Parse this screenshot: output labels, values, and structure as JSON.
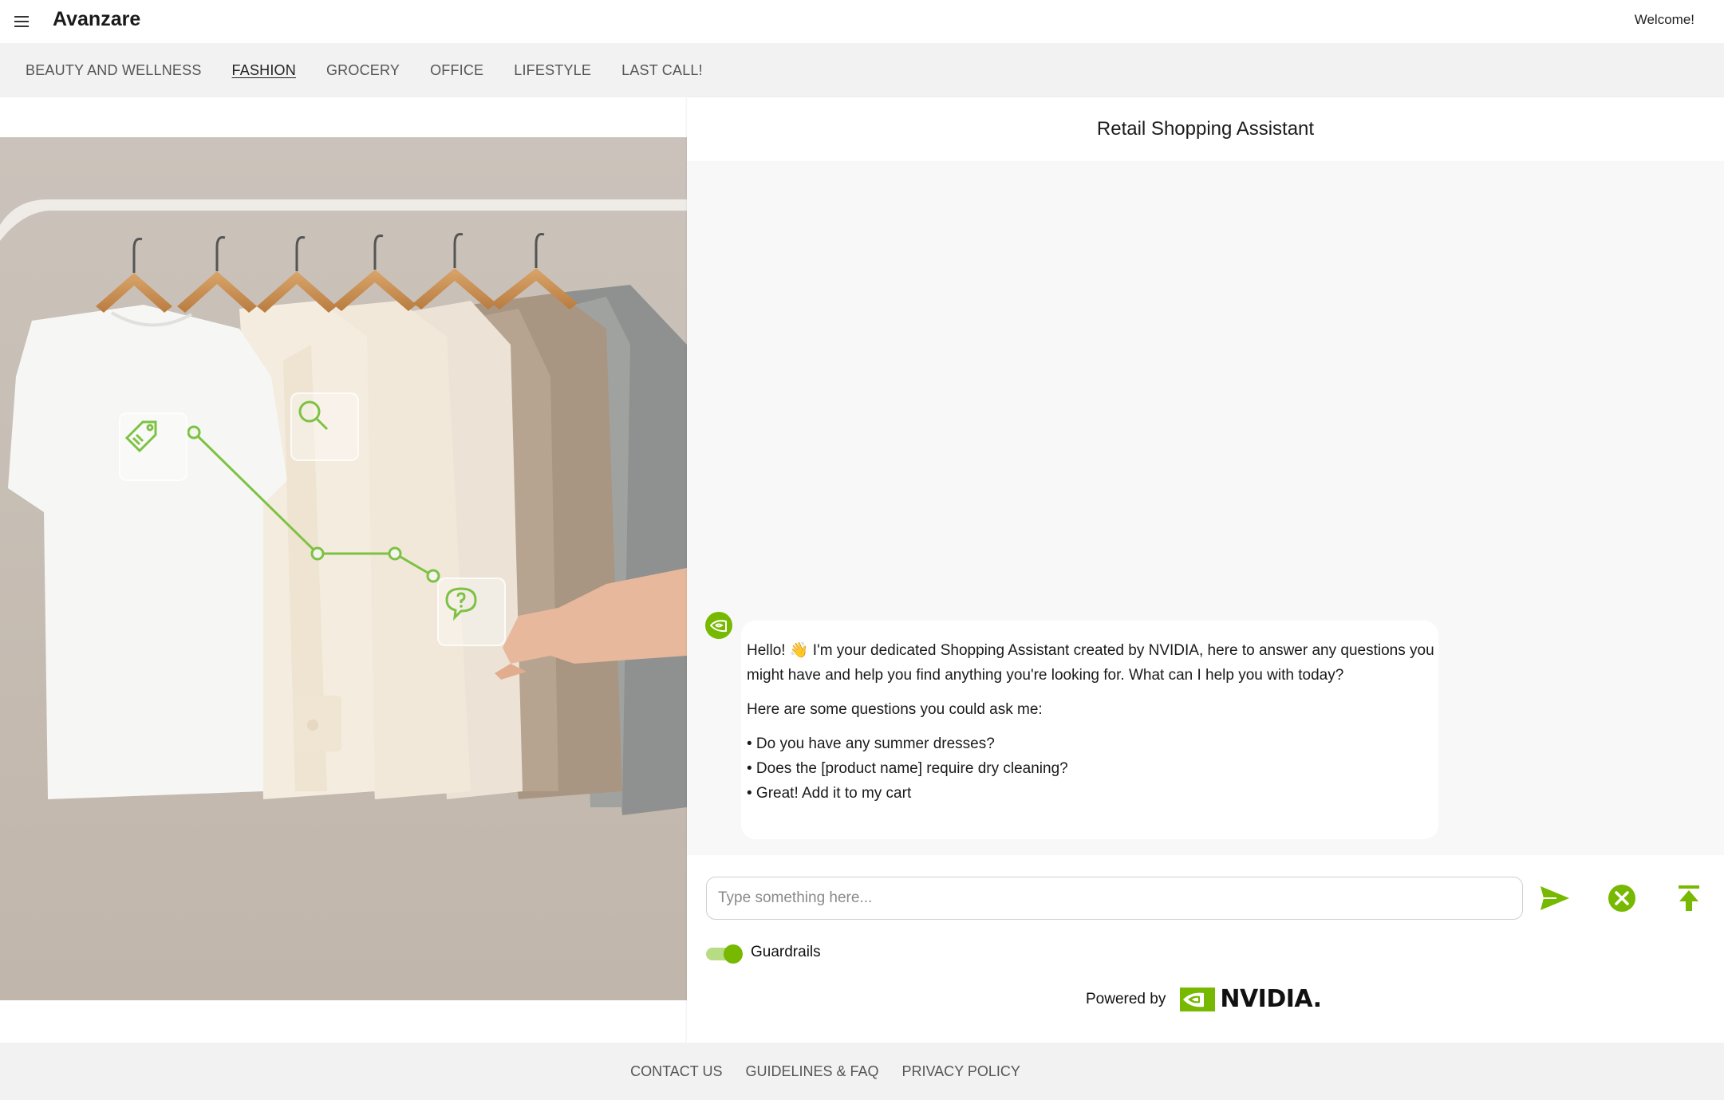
{
  "app": {
    "brand": "Avanzare",
    "welcome": "Welcome!"
  },
  "nav": {
    "categories": [
      {
        "label": "BEAUTY AND WELLNESS",
        "active": false
      },
      {
        "label": "FASHION",
        "active": true
      },
      {
        "label": "GROCERY",
        "active": false
      },
      {
        "label": "OFFICE",
        "active": false
      },
      {
        "label": "LIFESTYLE",
        "active": false
      },
      {
        "label": "LAST CALL!",
        "active": false
      }
    ]
  },
  "hero": {
    "image_description_icons": [
      "tag-icon",
      "search-icon",
      "chat-question-icon"
    ],
    "accent": "#7dc242"
  },
  "assistant": {
    "title": "Retail Shopping Assistant",
    "message": {
      "greeting": "Hello! 👋 I'm your dedicated Shopping Assistant created by NVIDIA, here to answer any questions you might have and help you find anything you're looking for. What can I help you with today?",
      "intro": "Here are some questions you could ask me:",
      "questions": [
        "• Do you have any summer dresses?",
        "• Does the [product name] require dry cleaning?",
        "• Great! Add it to my cart"
      ]
    },
    "input": {
      "placeholder": "Type something here...",
      "value": ""
    },
    "guardrails": {
      "label": "Guardrails",
      "enabled": true
    },
    "powered_by": "Powered by",
    "nvidia_word": "NVIDIA."
  },
  "footer": {
    "links": [
      "CONTACT US",
      "GUIDELINES & FAQ",
      "PRIVACY POLICY"
    ]
  },
  "colors": {
    "accent_green": "#76b900",
    "nav_bg": "#f2f2f2",
    "panel_bg": "#f8f8f8"
  }
}
